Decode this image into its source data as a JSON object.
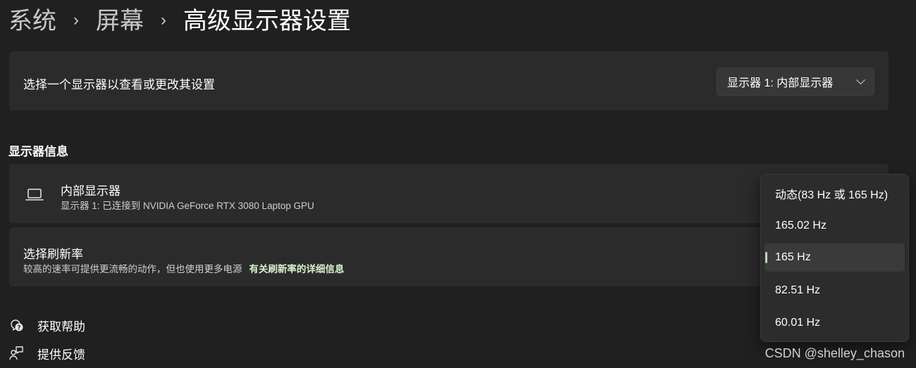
{
  "breadcrumb": {
    "items": [
      "系统",
      "屏幕"
    ],
    "current": "高级显示器设置",
    "separator": "›"
  },
  "select_display": {
    "label": "选择一个显示器以查看或更改其设置",
    "dropdown_value": "显示器 1: 内部显示器"
  },
  "display_info": {
    "section_heading": "显示器信息",
    "title": "内部显示器",
    "subtitle": "显示器 1: 已连接到 NVIDIA GeForce RTX 3080 Laptop GPU",
    "icon": "laptop-icon"
  },
  "refresh_rate": {
    "title": "选择刷新率",
    "description": "较高的速率可提供更流畅的动作，但也使用更多电源",
    "link": "有关刷新率的详细信息",
    "options": [
      "动态(83 Hz 或 165 Hz)",
      "165.02 Hz",
      "165 Hz",
      "82.51 Hz",
      "60.01 Hz"
    ],
    "selected": "165 Hz"
  },
  "footer": {
    "help": "获取帮助",
    "feedback": "提供反馈"
  },
  "watermark": "CSDN @shelley_chason",
  "colors": {
    "background": "#202020",
    "card": "#2b2b2b",
    "accent_indicator": "#b9d8b0",
    "link": "#d8f0d0"
  }
}
